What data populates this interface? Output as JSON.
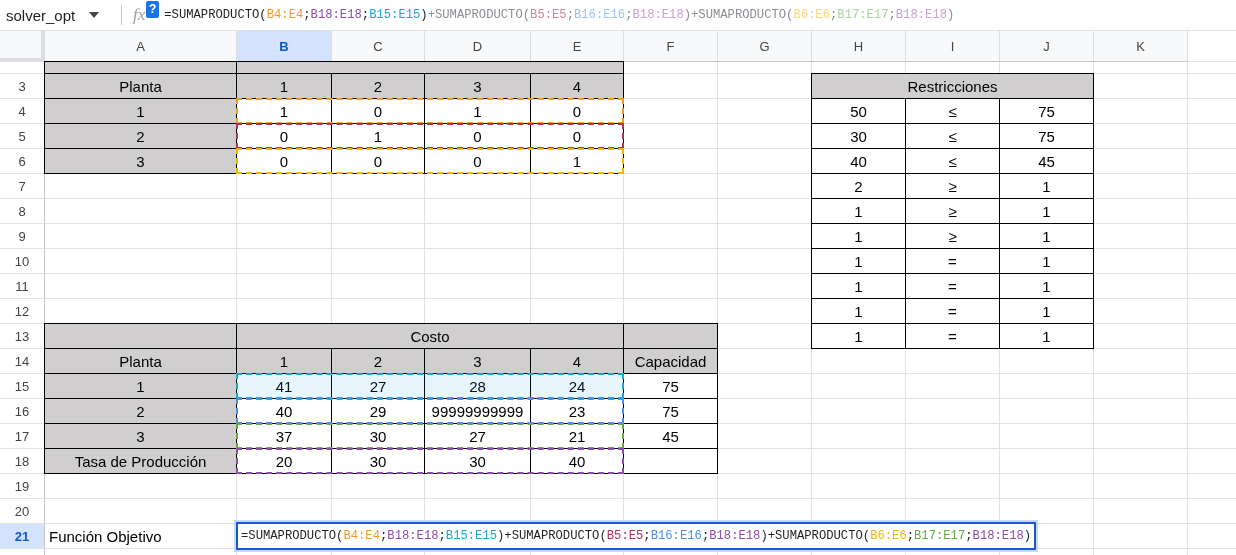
{
  "name_box": {
    "value": "solver_opt"
  },
  "formula_bar": {
    "function_label": "fx",
    "help_badge": "?",
    "segments": [
      {
        "text": "=SUMAPRODUCTO(",
        "dimmed": false
      },
      {
        "text": "B4:E4",
        "color": "#f29b22"
      },
      {
        "text": ";",
        "dimmed": false
      },
      {
        "text": "B18:E18",
        "color": "#8f4bab"
      },
      {
        "text": ";",
        "dimmed": false
      },
      {
        "text": "B15:E15",
        "color": "#1ba7cc"
      },
      {
        "text": ")",
        "dimmed": false
      },
      {
        "text": "+SUMAPRODUCTO(",
        "dimmed": true
      },
      {
        "text": "B5:E5",
        "color": "#d4849f"
      },
      {
        "text": ";",
        "dimmed": true
      },
      {
        "text": "B16:E16",
        "color": "#9ec1f5"
      },
      {
        "text": ";",
        "dimmed": true
      },
      {
        "text": "B18:E18",
        "color": "#c5a3d1"
      },
      {
        "text": ")+SUMAPRODUCTO(",
        "dimmed": true
      },
      {
        "text": "B6:E6",
        "color": "#f9d77a"
      },
      {
        "text": ";",
        "dimmed": true
      },
      {
        "text": "B17:E17",
        "color": "#a9d39a"
      },
      {
        "text": ";",
        "dimmed": true
      },
      {
        "text": "B18:E18",
        "color": "#c5a3d1"
      },
      {
        "text": ")",
        "dimmed": true
      }
    ]
  },
  "columns": [
    {
      "label": "A",
      "selected": false
    },
    {
      "label": "B",
      "selected": true
    },
    {
      "label": "C",
      "selected": false
    },
    {
      "label": "D",
      "selected": false
    },
    {
      "label": "E",
      "selected": false
    },
    {
      "label": "F",
      "selected": false
    },
    {
      "label": "G",
      "selected": false
    },
    {
      "label": "H",
      "selected": false
    },
    {
      "label": "I",
      "selected": false
    },
    {
      "label": "J",
      "selected": false
    },
    {
      "label": "K",
      "selected": false
    }
  ],
  "rows": [
    {
      "selected": false,
      "clipped": true,
      "cells": [
        {
          "kind": "header"
        },
        {
          "kind": "header"
        },
        {
          "kind": "merged"
        },
        {
          "kind": "merged"
        },
        {
          "kind": "merged"
        }
      ]
    },
    {
      "label": "3",
      "selected": false,
      "cells": [
        {
          "kind": "header",
          "text": "Planta"
        },
        {
          "kind": "header",
          "text": "1"
        },
        {
          "kind": "header",
          "text": "2"
        },
        {
          "kind": "header",
          "text": "3"
        },
        {
          "kind": "header",
          "text": "4"
        },
        {
          "kind": "blank"
        },
        {
          "kind": "blank"
        },
        {
          "kind": "header",
          "text": "Restricciones"
        },
        {
          "kind": "merged"
        },
        {
          "kind": "merged"
        }
      ]
    },
    {
      "label": "4",
      "selected": false,
      "range_highlight": {
        "color": "#f29b22",
        "filled": false
      },
      "cells": [
        {
          "kind": "header",
          "text": "1"
        },
        {
          "kind": "value",
          "text": "1"
        },
        {
          "kind": "value",
          "text": "0"
        },
        {
          "kind": "value",
          "text": "1"
        },
        {
          "kind": "value",
          "text": "0"
        },
        {
          "kind": "blank"
        },
        {
          "kind": "blank"
        },
        {
          "kind": "value",
          "text": "50"
        },
        {
          "kind": "value",
          "text": "≤"
        },
        {
          "kind": "value",
          "text": "75"
        }
      ]
    },
    {
      "label": "5",
      "selected": false,
      "range_highlight": {
        "color": "#b3305e",
        "filled": false
      },
      "cells": [
        {
          "kind": "header",
          "text": "2"
        },
        {
          "kind": "value",
          "text": "0"
        },
        {
          "kind": "value",
          "text": "1"
        },
        {
          "kind": "value",
          "text": "0"
        },
        {
          "kind": "value",
          "text": "0"
        },
        {
          "kind": "blank"
        },
        {
          "kind": "blank"
        },
        {
          "kind": "value",
          "text": "30"
        },
        {
          "kind": "value",
          "text": "≤"
        },
        {
          "kind": "value",
          "text": "75"
        }
      ]
    },
    {
      "label": "6",
      "selected": false,
      "range_highlight": {
        "color": "#f4b400",
        "filled": false
      },
      "cells": [
        {
          "kind": "header",
          "text": "3"
        },
        {
          "kind": "value",
          "text": "0"
        },
        {
          "kind": "value",
          "text": "0"
        },
        {
          "kind": "value",
          "text": "0"
        },
        {
          "kind": "value",
          "text": "1"
        },
        {
          "kind": "blank"
        },
        {
          "kind": "blank"
        },
        {
          "kind": "value",
          "text": "40"
        },
        {
          "kind": "value",
          "text": "≤"
        },
        {
          "kind": "value",
          "text": "45"
        }
      ]
    },
    {
      "label": "7",
      "selected": false,
      "cells": [
        {
          "kind": "blank"
        },
        {
          "kind": "blank"
        },
        {
          "kind": "blank"
        },
        {
          "kind": "blank"
        },
        {
          "kind": "blank"
        },
        {
          "kind": "blank"
        },
        {
          "kind": "blank"
        },
        {
          "kind": "value",
          "text": "2"
        },
        {
          "kind": "value",
          "text": "≥"
        },
        {
          "kind": "value",
          "text": "1"
        }
      ]
    },
    {
      "label": "8",
      "selected": false,
      "cells": [
        {
          "kind": "blank"
        },
        {
          "kind": "blank"
        },
        {
          "kind": "blank"
        },
        {
          "kind": "blank"
        },
        {
          "kind": "blank"
        },
        {
          "kind": "blank"
        },
        {
          "kind": "blank"
        },
        {
          "kind": "value",
          "text": "1"
        },
        {
          "kind": "value",
          "text": "≥"
        },
        {
          "kind": "value",
          "text": "1"
        }
      ]
    },
    {
      "label": "9",
      "selected": false,
      "cells": [
        {
          "kind": "blank"
        },
        {
          "kind": "blank"
        },
        {
          "kind": "blank"
        },
        {
          "kind": "blank"
        },
        {
          "kind": "blank"
        },
        {
          "kind": "blank"
        },
        {
          "kind": "blank"
        },
        {
          "kind": "value",
          "text": "1"
        },
        {
          "kind": "value",
          "text": "≥"
        },
        {
          "kind": "value",
          "text": "1"
        }
      ]
    },
    {
      "label": "10",
      "selected": false,
      "cells": [
        {
          "kind": "blank"
        },
        {
          "kind": "blank"
        },
        {
          "kind": "blank"
        },
        {
          "kind": "blank"
        },
        {
          "kind": "blank"
        },
        {
          "kind": "blank"
        },
        {
          "kind": "blank"
        },
        {
          "kind": "value",
          "text": "1"
        },
        {
          "kind": "value",
          "text": "="
        },
        {
          "kind": "value",
          "text": "1"
        }
      ]
    },
    {
      "label": "11",
      "selected": false,
      "cells": [
        {
          "kind": "blank"
        },
        {
          "kind": "blank"
        },
        {
          "kind": "blank"
        },
        {
          "kind": "blank"
        },
        {
          "kind": "blank"
        },
        {
          "kind": "blank"
        },
        {
          "kind": "blank"
        },
        {
          "kind": "value",
          "text": "1"
        },
        {
          "kind": "value",
          "text": "="
        },
        {
          "kind": "value",
          "text": "1"
        }
      ]
    },
    {
      "label": "12",
      "selected": false,
      "cells": [
        {
          "kind": "blank"
        },
        {
          "kind": "blank"
        },
        {
          "kind": "blank"
        },
        {
          "kind": "blank"
        },
        {
          "kind": "blank"
        },
        {
          "kind": "blank"
        },
        {
          "kind": "blank"
        },
        {
          "kind": "value",
          "text": "1"
        },
        {
          "kind": "value",
          "text": "="
        },
        {
          "kind": "value",
          "text": "1"
        }
      ]
    },
    {
      "label": "13",
      "selected": false,
      "cells": [
        {
          "kind": "header"
        },
        {
          "kind": "header",
          "text": "Costo"
        },
        {
          "kind": "merged"
        },
        {
          "kind": "merged"
        },
        {
          "kind": "merged"
        },
        {
          "kind": "header"
        },
        {
          "kind": "blank"
        },
        {
          "kind": "value",
          "text": "1"
        },
        {
          "kind": "value",
          "text": "="
        },
        {
          "kind": "value",
          "text": "1"
        }
      ]
    },
    {
      "label": "14",
      "selected": false,
      "cells": [
        {
          "kind": "header",
          "text": "Planta"
        },
        {
          "kind": "header",
          "text": "1"
        },
        {
          "kind": "header",
          "text": "2"
        },
        {
          "kind": "header",
          "text": "3"
        },
        {
          "kind": "header",
          "text": "4"
        },
        {
          "kind": "header",
          "text": "Capacidad"
        }
      ]
    },
    {
      "label": "15",
      "selected": false,
      "range_highlight": {
        "color": "#1ba7cc",
        "filled": true
      },
      "cells": [
        {
          "kind": "header",
          "text": "1"
        },
        {
          "kind": "value",
          "text": "41"
        },
        {
          "kind": "value",
          "text": "27"
        },
        {
          "kind": "value",
          "text": "28"
        },
        {
          "kind": "value",
          "text": "24"
        },
        {
          "kind": "value",
          "text": "75"
        }
      ]
    },
    {
      "label": "16",
      "selected": false,
      "range_highlight": {
        "color": "#4a8cf0",
        "filled": false
      },
      "cells": [
        {
          "kind": "header",
          "text": "2"
        },
        {
          "kind": "value",
          "text": "40"
        },
        {
          "kind": "value",
          "text": "29"
        },
        {
          "kind": "value",
          "text": "99999999999"
        },
        {
          "kind": "value",
          "text": "23"
        },
        {
          "kind": "value",
          "text": "75"
        }
      ]
    },
    {
      "label": "17",
      "selected": false,
      "range_highlight": {
        "color": "#62ab3d",
        "filled": false
      },
      "cells": [
        {
          "kind": "header",
          "text": "3"
        },
        {
          "kind": "value",
          "text": "37"
        },
        {
          "kind": "value",
          "text": "30"
        },
        {
          "kind": "value",
          "text": "27"
        },
        {
          "kind": "value",
          "text": "21"
        },
        {
          "kind": "value",
          "text": "45"
        }
      ]
    },
    {
      "label": "18",
      "selected": false,
      "range_highlight": {
        "color": "#8f4bab",
        "filled": false
      },
      "cells": [
        {
          "kind": "header",
          "text": "Tasa de Producción"
        },
        {
          "kind": "value",
          "text": "20"
        },
        {
          "kind": "value",
          "text": "30"
        },
        {
          "kind": "value",
          "text": "30"
        },
        {
          "kind": "value",
          "text": "40"
        },
        {
          "kind": "value"
        }
      ]
    },
    {
      "label": "19",
      "selected": false
    },
    {
      "label": "20",
      "selected": false
    },
    {
      "label": "21",
      "selected": true,
      "cells": [
        {
          "kind": "label",
          "text": "Función Objetivo"
        },
        {
          "kind": "formula",
          "segments": [
            {
              "text": "=SUMAPRODUCTO("
            },
            {
              "text": "B4:E4",
              "color": "#f29b22"
            },
            {
              "text": ";"
            },
            {
              "text": "B18:E18",
              "color": "#8f4bab"
            },
            {
              "text": ";"
            },
            {
              "text": "B15:E15",
              "color": "#1ba7cc"
            },
            {
              "text": ")+SUMAPRODUCTO("
            },
            {
              "text": "B5:E5",
              "color": "#b3305e"
            },
            {
              "text": ";"
            },
            {
              "text": "B16:E16",
              "color": "#4a8cf0"
            },
            {
              "text": ";"
            },
            {
              "text": "B18:E18",
              "color": "#8f4bab"
            },
            {
              "text": ")+SUMAPRODUCTO("
            },
            {
              "text": "B6:E6",
              "color": "#f4b400"
            },
            {
              "text": ";"
            },
            {
              "text": "B17:E17",
              "color": "#62ab3d"
            },
            {
              "text": ";"
            },
            {
              "text": "B18:E18",
              "color": "#8f4bab"
            },
            {
              "text": ")"
            }
          ]
        }
      ]
    }
  ]
}
